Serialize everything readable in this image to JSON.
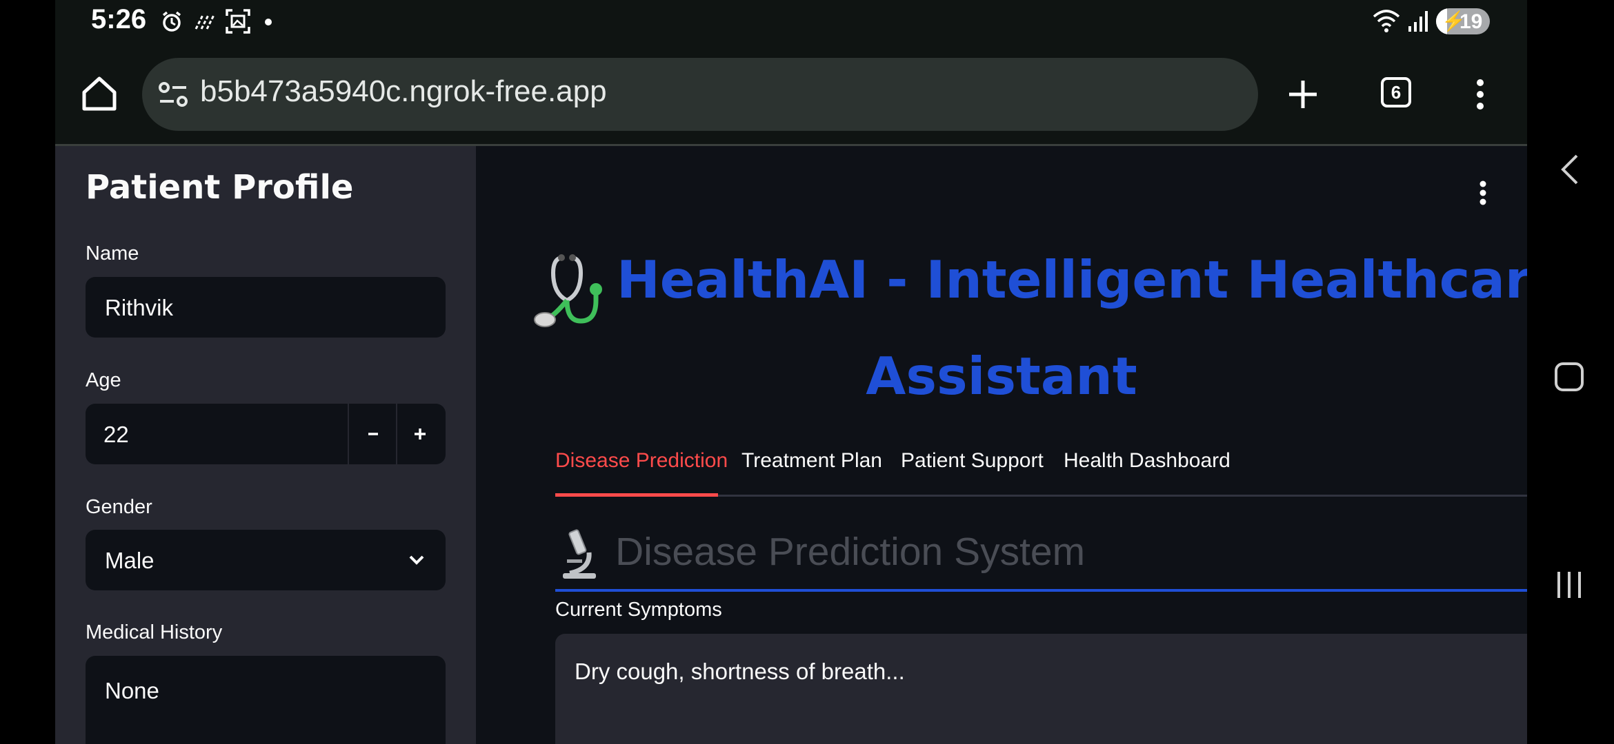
{
  "status_bar": {
    "time": "5:26",
    "battery": "19",
    "icons": [
      "alarm-icon",
      "signal-icon",
      "screenshot-icon",
      "dot-icon",
      "wifi-icon",
      "cell-signal-icon",
      "battery-icon"
    ]
  },
  "browser": {
    "url": "b5b473a5940c.ngrok-free.app",
    "tab_count": "6"
  },
  "sidebar": {
    "title": "Patient Profile",
    "name_label": "Name",
    "name_value": "Rithvik",
    "age_label": "Age",
    "age_value": "22",
    "gender_label": "Gender",
    "gender_value": "Male",
    "history_label": "Medical History",
    "history_value": "None"
  },
  "main": {
    "title_line1": "HealthAI - Intelligent Healthcare",
    "title_line2": "Assistant",
    "tabs": [
      {
        "label": "Disease Prediction",
        "active": true
      },
      {
        "label": "Treatment Plan",
        "active": false
      },
      {
        "label": "Patient Support",
        "active": false
      },
      {
        "label": "Health Dashboard",
        "active": false
      }
    ],
    "section_title": "Disease Prediction System",
    "symptoms_label": "Current Symptoms",
    "symptoms_placeholder": "Dry cough, shortness of breath..."
  },
  "colors": {
    "accent_red": "#ff4b4b",
    "title_blue": "#1f4fd6",
    "sidebar_bg": "#262730",
    "main_bg": "#0e1117"
  }
}
